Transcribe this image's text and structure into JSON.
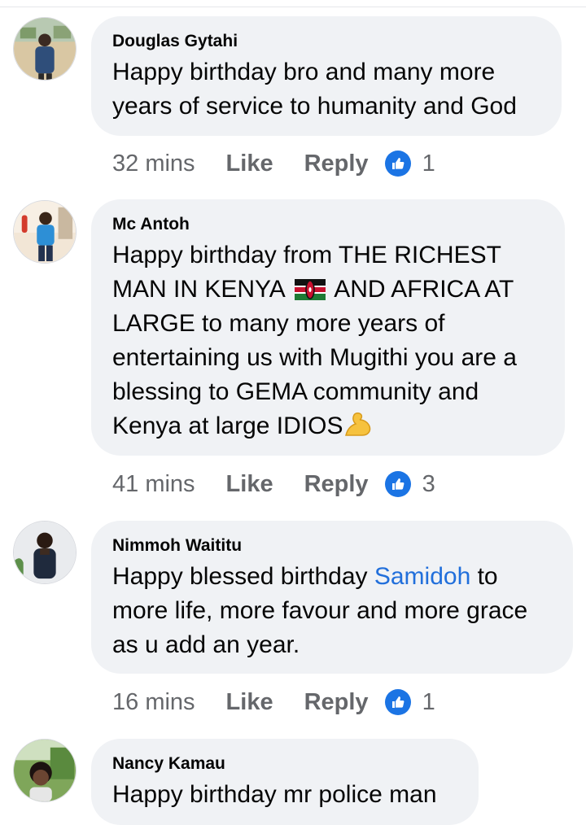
{
  "comments": [
    {
      "author": "Douglas Gytahi",
      "text_parts": [
        "Happy birthday bro and many more years of service to humanity and God"
      ],
      "time": "32 mins",
      "like_label": "Like",
      "reply_label": "Reply",
      "reaction_count": "1",
      "reaction_icon": "thumbs-up-icon"
    },
    {
      "author": "Mc Antoh",
      "text_line1": "Happy birthday from THE RICHEST",
      "text_line2a": "MAN IN KENYA",
      "flag_icon": "kenya-flag-emoji",
      "text_line2b": "AND AFRICA AT",
      "text_rest": "LARGE to many more years of entertaining us with Mugithi you are a blessing to GEMA community and Kenya at large IDIOS",
      "trailing_emoji": "flexed-biceps-emoji",
      "time": "41 mins",
      "like_label": "Like",
      "reply_label": "Reply",
      "reaction_count": "3",
      "reaction_icon": "thumbs-up-icon"
    },
    {
      "author": "Nimmoh Waititu",
      "text_before": "Happy blessed birthday ",
      "mention": "Samidoh",
      "text_after": " to more life, more favour and more grace as u add an year.",
      "time": "16 mins",
      "like_label": "Like",
      "reply_label": "Reply",
      "reaction_count": "1",
      "reaction_icon": "thumbs-up-icon"
    },
    {
      "author": "Nancy Kamau",
      "text": "Happy birthday mr police man"
    }
  ],
  "colors": {
    "bubble": "#f0f2f5",
    "meta": "#65676b",
    "mention": "#216fdb",
    "like_badge": "#1b74e4"
  }
}
